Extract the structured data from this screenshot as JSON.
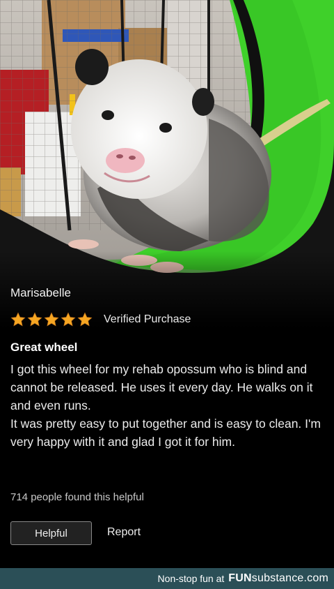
{
  "photo": {
    "subject": "opossum on green exercise wheel"
  },
  "review": {
    "reviewer_name": "Marisabelle",
    "rating": 5,
    "rating_max": 5,
    "star_color": "#f5a623",
    "verified_label": "Verified Purchase",
    "title": "Great wheel",
    "body_paragraph_1": "I got this wheel for my rehab opossum who is blind and cannot be released. He uses it every day. He walks on it and even runs.",
    "body_paragraph_2": "It was pretty easy to put together and is easy to clean. I'm very happy with it and glad I got it for him.",
    "helpful_count_text": "714 people found this helpful",
    "helpful_button_label": "Helpful",
    "report_label": "Report"
  },
  "footer": {
    "tagline": "Non-stop fun at",
    "brand_prefix": "FUN",
    "brand_suffix": "substance",
    "brand_domain": ".com",
    "background_color": "#2b4f57"
  }
}
